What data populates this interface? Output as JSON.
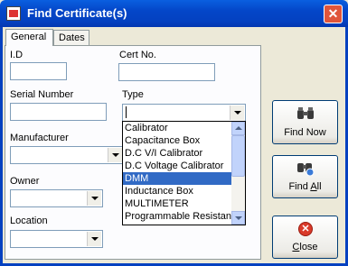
{
  "window": {
    "title": "Find Certificate(s)",
    "close_glyph": "✕"
  },
  "tabs": [
    {
      "label": "General"
    },
    {
      "label": "Dates"
    }
  ],
  "fields": {
    "id_label": "I.D",
    "cert_label": "Cert No.",
    "serial_label": "Serial Number",
    "type_label": "Type",
    "manufacturer_label": "Manufacturer",
    "owner_label": "Owner",
    "location_label": "Location"
  },
  "type_dropdown": {
    "options": [
      "Calibrator",
      "Capacitance Box",
      "D.C V/I Calibrator",
      "D.C Voltage Calibrator",
      "DMM",
      "Inductance Box",
      "MULTIMETER",
      "Programmable Resistance"
    ],
    "highlighted": "DMM"
  },
  "buttons": {
    "find_now": "Find Now",
    "find_all_prefix": "Find ",
    "find_all_accel": "A",
    "find_all_suffix": "ll",
    "close_accel": "C",
    "close_suffix": "lose",
    "close_glyph": "✕"
  },
  "icons": [
    "binoculars-icon",
    "binoculars-globe-icon",
    "close-circle-icon",
    "certificate-app-icon"
  ]
}
